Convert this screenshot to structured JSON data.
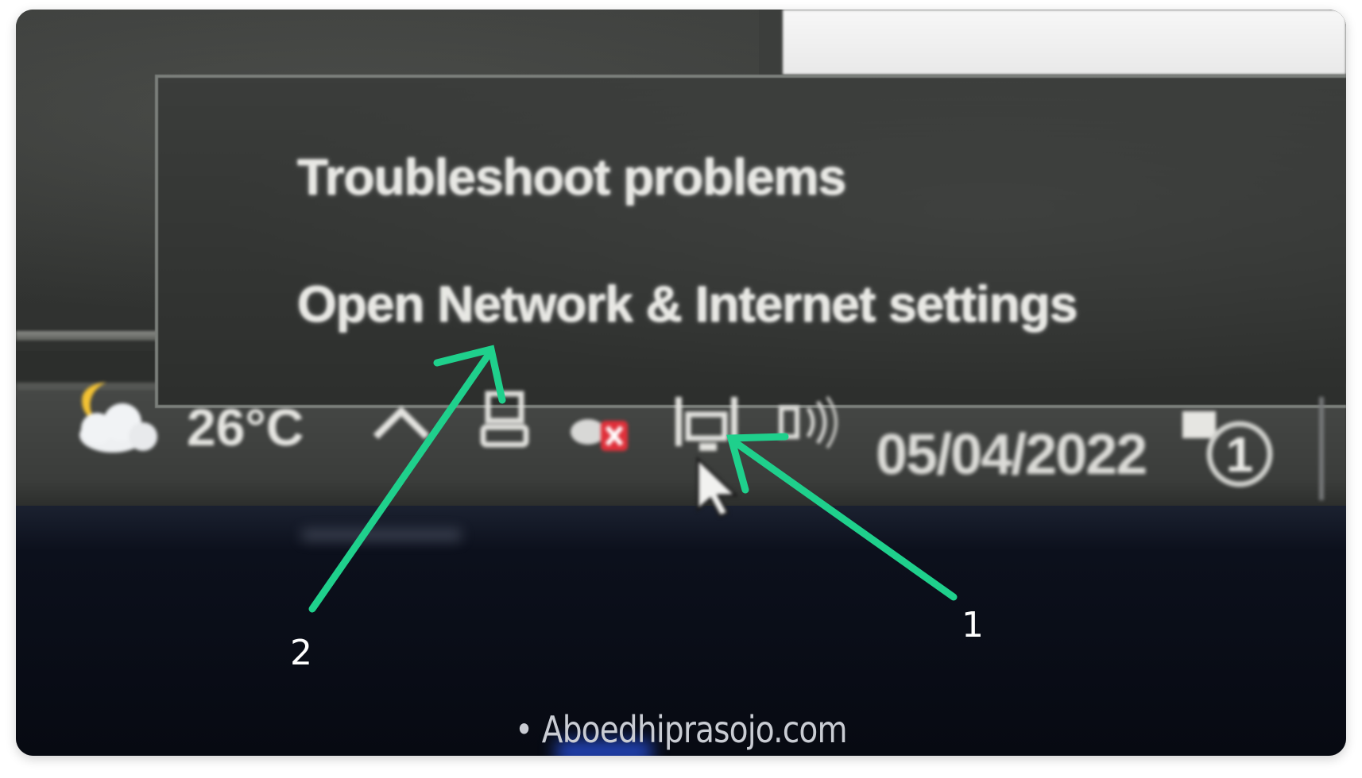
{
  "context_menu": {
    "items": [
      {
        "label": "Troubleshoot problems"
      },
      {
        "label": "Open Network & Internet settings"
      }
    ]
  },
  "taskbar": {
    "weather": {
      "icon": "partly-cloudy-night-icon",
      "temperature": "26°C"
    },
    "tray_icons": [
      "chevron-up-icon",
      "device-icon",
      "antivirus-icon",
      "network-icon",
      "volume-icon"
    ],
    "date": "05/04/2022",
    "notification": {
      "icon": "notification-icon",
      "count": "1"
    }
  },
  "annotations": {
    "arrow_1_label": "1",
    "arrow_2_label": "2",
    "arrow_color": "#1fd08c"
  },
  "watermark": "• Aboedhiprasojo.com"
}
